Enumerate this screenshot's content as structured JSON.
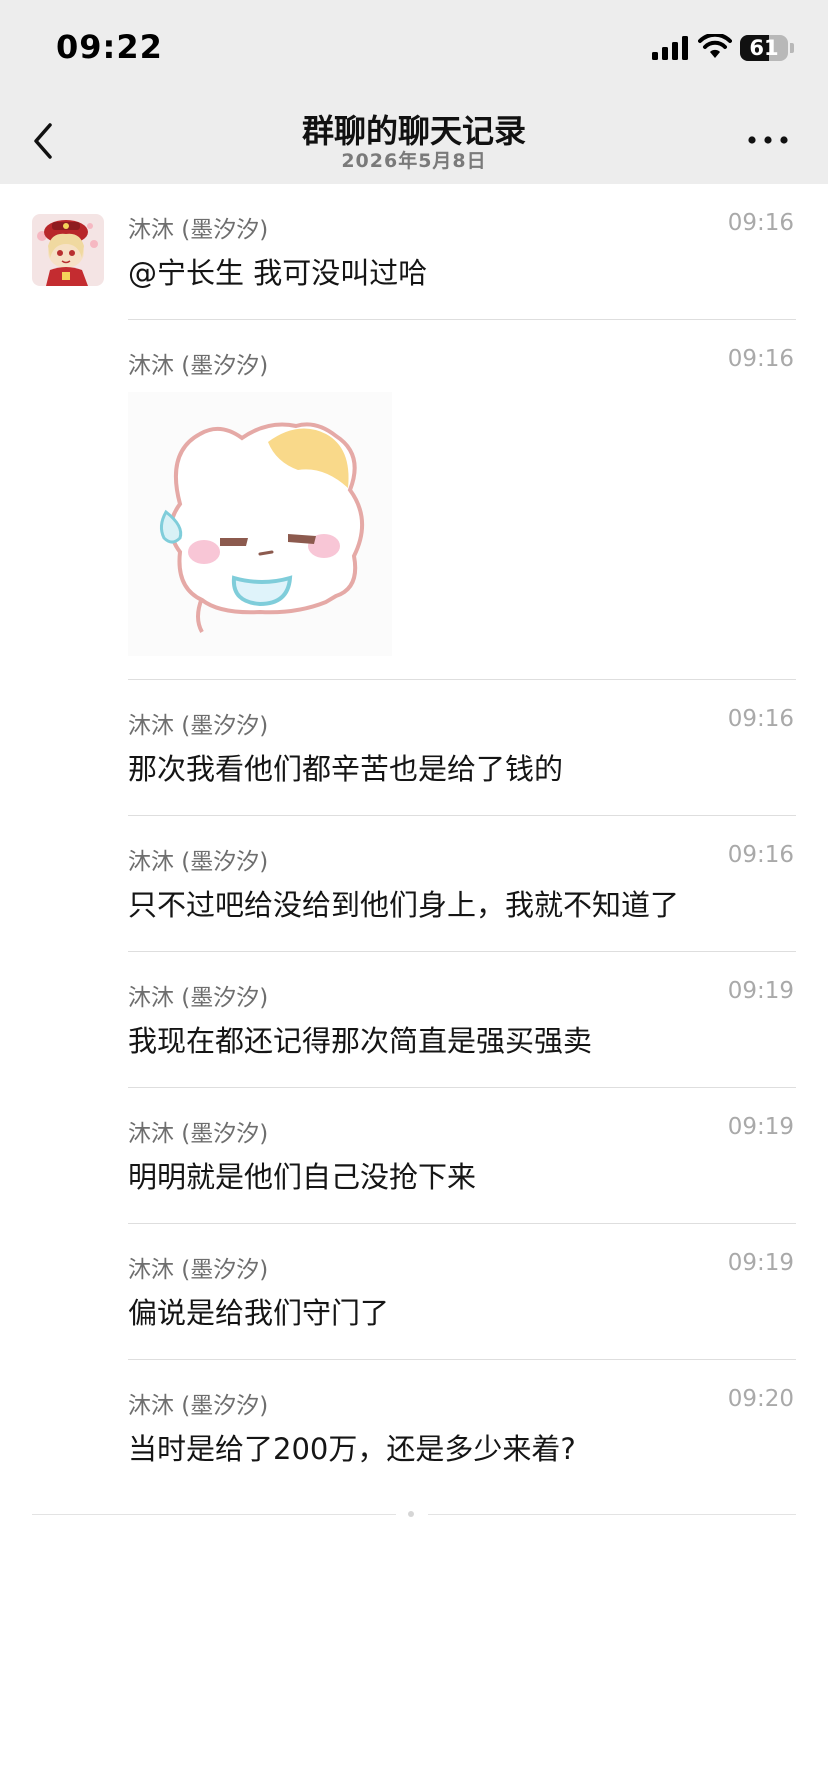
{
  "status_bar": {
    "time": "09:22",
    "battery": "61",
    "battery_level": 0.61,
    "icons": [
      "signal-icon",
      "wifi-icon",
      "battery-icon"
    ]
  },
  "nav": {
    "title": "群聊的聊天记录",
    "date": "2026年5月8日",
    "icons": [
      "back-chevron-icon",
      "more-dots-icon"
    ]
  },
  "messages": [
    {
      "sender": "沐沐 (墨汐汐)",
      "time": "09:16",
      "text": "@宁长生 我可没叫过哈",
      "avatar": true
    },
    {
      "sender": "沐沐 (墨汐汐)",
      "time": "09:16",
      "sticker": "sweating-hamster-sticker"
    },
    {
      "sender": "沐沐 (墨汐汐)",
      "time": "09:16",
      "text": "那次我看他们都辛苦也是给了钱的"
    },
    {
      "sender": "沐沐 (墨汐汐)",
      "time": "09:16",
      "text": "只不过吧给没给到他们身上，我就不知道了"
    },
    {
      "sender": "沐沐 (墨汐汐)",
      "time": "09:19",
      "text": "我现在都还记得那次简直是强买强卖"
    },
    {
      "sender": "沐沐 (墨汐汐)",
      "time": "09:19",
      "text": "明明就是他们自己没抢下来"
    },
    {
      "sender": "沐沐 (墨汐汐)",
      "time": "09:19",
      "text": "偏说是给我们守门了"
    },
    {
      "sender": "沐沐 (墨汐汐)",
      "time": "09:20",
      "text": "当时是给了200万，还是多少来着?"
    }
  ],
  "colors": {
    "header_bg": "#ededed",
    "sender_gray": "#6e6e6e",
    "time_gray": "#a9a9a9",
    "text": "#151515",
    "divider": "#dedede"
  }
}
